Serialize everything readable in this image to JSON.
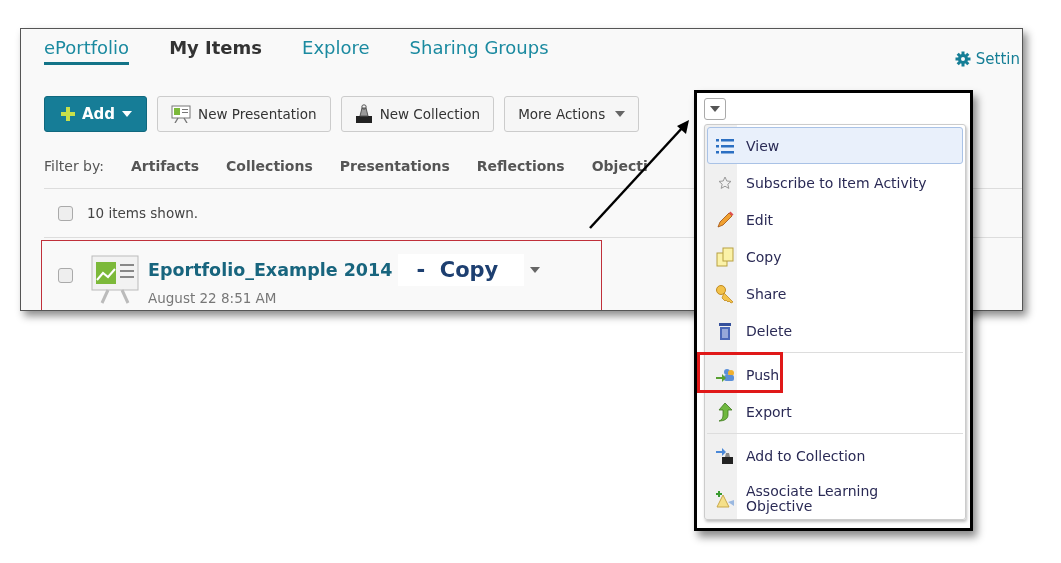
{
  "nav": [
    {
      "label": "ePortfolio",
      "kind": "tab",
      "selected": true
    },
    {
      "label": "My Items",
      "kind": "heading",
      "selected": false
    },
    {
      "label": "Explore",
      "kind": "tab",
      "selected": false
    },
    {
      "label": "Sharing Groups",
      "kind": "tab",
      "selected": false
    }
  ],
  "settings": {
    "label": "Settin"
  },
  "toolbar": [
    {
      "label": "Add",
      "kind": "primary"
    },
    {
      "label": "New Presentation",
      "kind": "presentation"
    },
    {
      "label": "New Collection",
      "kind": "collection"
    },
    {
      "label": "More Actions",
      "kind": "dropdown"
    }
  ],
  "filter": {
    "label": "Filter by:",
    "options": [
      "Artifacts",
      "Collections",
      "Presentations",
      "Reflections",
      "Objecti"
    ]
  },
  "summary": {
    "text": "10 items shown.",
    "checked": false
  },
  "item": {
    "title": "Eportfolio_Example 2014",
    "annotation": "-  Copy",
    "date": "August 22 8:51 AM",
    "checked": false,
    "annotated": true
  },
  "menu": {
    "groups": [
      [
        {
          "label": "View",
          "selected": true,
          "annotated": false
        },
        {
          "label": "Subscribe to Item Activity",
          "selected": false,
          "annotated": false
        },
        {
          "label": "Edit",
          "selected": false,
          "annotated": false
        },
        {
          "label": "Copy",
          "selected": false,
          "annotated": false
        },
        {
          "label": "Share",
          "selected": false,
          "annotated": false
        },
        {
          "label": "Delete",
          "selected": false,
          "annotated": false
        }
      ],
      [
        {
          "label": "Push",
          "selected": false,
          "annotated": true
        },
        {
          "label": "Export",
          "selected": false,
          "annotated": false
        }
      ],
      [
        {
          "label": "Add to Collection",
          "selected": false,
          "annotated": false
        },
        {
          "label": "Associate Learning Objective",
          "selected": false,
          "annotated": false
        }
      ]
    ]
  }
}
